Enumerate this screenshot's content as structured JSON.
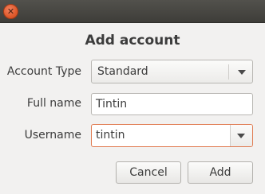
{
  "dialog": {
    "title": "Add account"
  },
  "form": {
    "account_type": {
      "label": "Account Type",
      "value": "Standard"
    },
    "full_name": {
      "label": "Full name",
      "value": "Tintin"
    },
    "username": {
      "label": "Username",
      "value": "tintin"
    }
  },
  "buttons": {
    "cancel": "Cancel",
    "add": "Add"
  },
  "icons": {
    "close": "close-icon",
    "dropdown": "chevron-down-icon"
  },
  "colors": {
    "titlebar": "#45443f",
    "close_button": "#df5a2c",
    "focus_border": "#e07a50"
  }
}
